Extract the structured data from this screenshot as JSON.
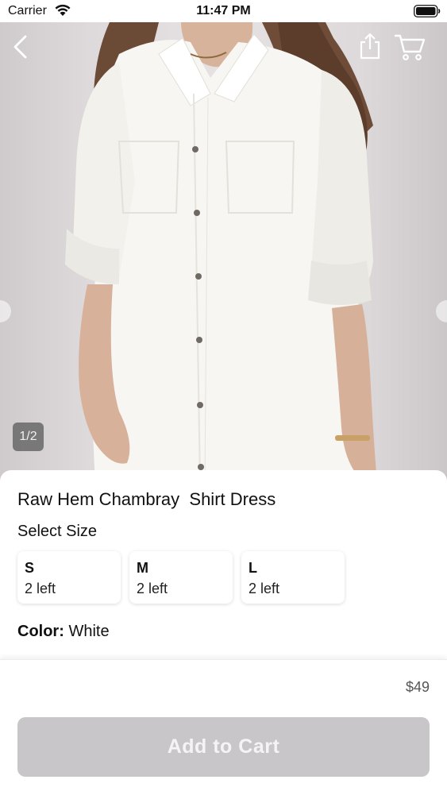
{
  "status_bar": {
    "carrier": "Carrier",
    "time": "11:47 PM"
  },
  "gallery": {
    "page_counter": "1/2",
    "icons": [
      "back-arrow-icon",
      "share-icon",
      "cart-icon"
    ]
  },
  "product": {
    "title": "Raw Hem Chambray  Shirt Dress",
    "select_size_label": "Select Size",
    "sizes": [
      {
        "size": "S",
        "stock": "2 left"
      },
      {
        "size": "M",
        "stock": "2 left"
      },
      {
        "size": "L",
        "stock": "2 left"
      }
    ],
    "color_label": "Color:",
    "color_value": " White"
  },
  "footer": {
    "price": "$49",
    "add_to_cart_label": "Add to Cart"
  },
  "colors": {
    "button_disabled": "#c8c6c9",
    "accent_text": "#111111"
  }
}
